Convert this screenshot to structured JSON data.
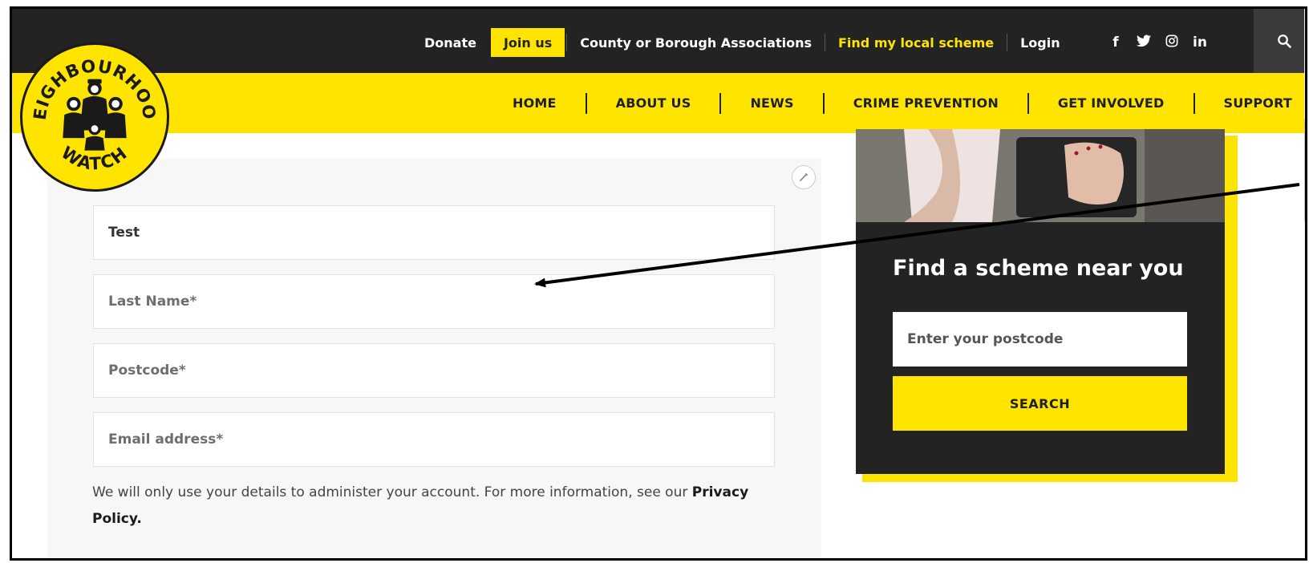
{
  "topbar": {
    "donate": "Donate",
    "join": "Join us",
    "county": "County or Borough Associations",
    "find_local": "Find my local scheme",
    "login": "Login",
    "social": [
      "f",
      "𝕏",
      "◎",
      "in"
    ],
    "search_icon": "search-icon"
  },
  "nav": {
    "items": [
      "HOME",
      "ABOUT US",
      "NEWS",
      "CRIME PREVENTION",
      "GET INVOLVED",
      "SUPPORT"
    ]
  },
  "logo": {
    "top_text": "NEIGHBOURHOOD",
    "bottom_text": "WATCH"
  },
  "form": {
    "first_name_value": "Test",
    "last_name_placeholder": "Last Name*",
    "postcode_placeholder": "Postcode*",
    "email_placeholder": "Email address*",
    "privacy_text": "We will only use your details to administer your account. For more information, see our ",
    "privacy_link": "Privacy Policy."
  },
  "sidebar": {
    "title": "Find a scheme near you",
    "postcode_placeholder": "Enter your postcode",
    "search_label": "SEARCH"
  },
  "colors": {
    "brand_yellow": "#ffe400",
    "dark": "#232323"
  }
}
